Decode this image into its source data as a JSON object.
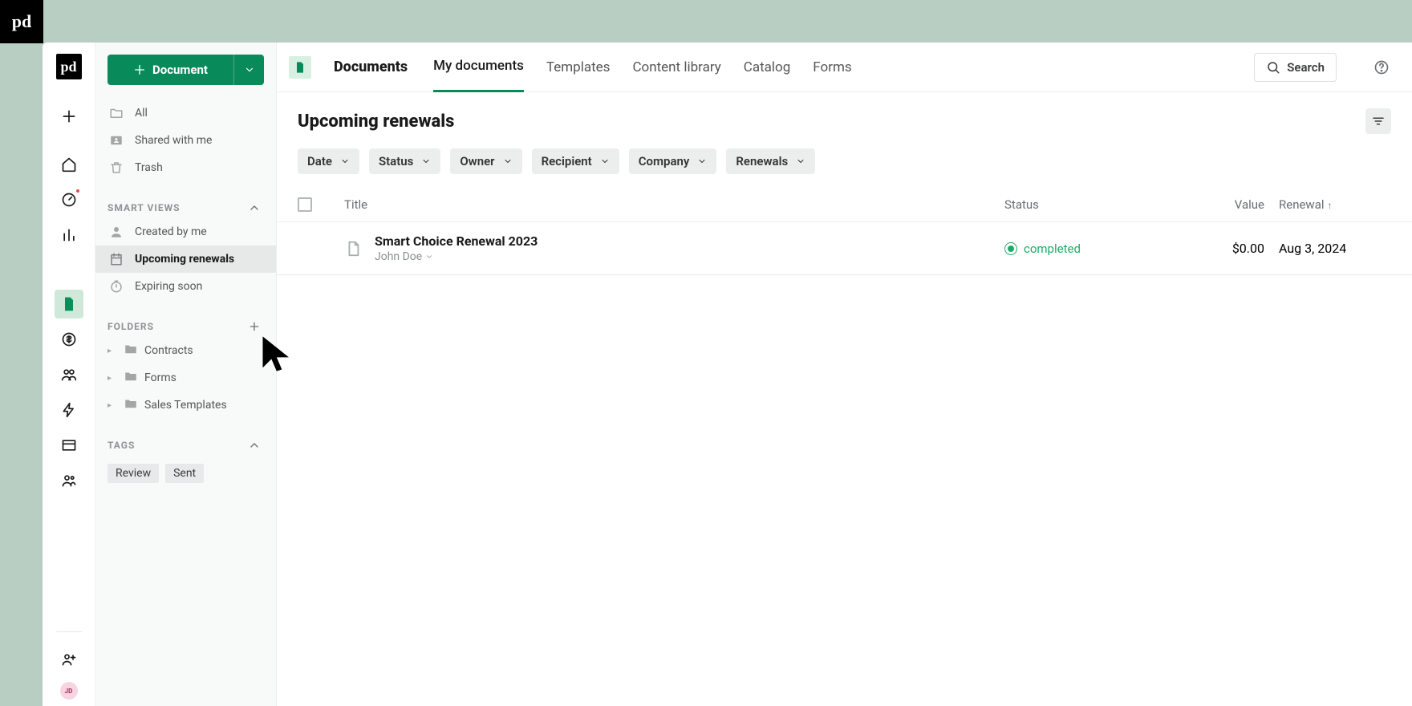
{
  "app": {
    "brand_mark": "pd",
    "brand_label": "Documents",
    "nav_tabs": [
      "My documents",
      "Templates",
      "Content library",
      "Catalog",
      "Forms"
    ],
    "active_tab_index": 0,
    "search_label": "Search"
  },
  "rail": {
    "avatar_initials": "JD"
  },
  "sidebar": {
    "document_button_label": "Document",
    "quick_items": [
      {
        "key": "all",
        "label": "All"
      },
      {
        "key": "shared",
        "label": "Shared with me"
      },
      {
        "key": "trash",
        "label": "Trash"
      }
    ],
    "smart_views_header": "SMART VIEWS",
    "smart_views": [
      {
        "key": "created_by_me",
        "label": "Created by me"
      },
      {
        "key": "upcoming_renewals",
        "label": "Upcoming renewals",
        "selected": true
      },
      {
        "key": "expiring_soon",
        "label": "Expiring soon"
      }
    ],
    "folders_header": "FOLDERS",
    "folders": [
      {
        "label": "Contracts"
      },
      {
        "label": "Forms"
      },
      {
        "label": "Sales Templates"
      }
    ],
    "tags_header": "TAGS",
    "tags": [
      "Review",
      "Sent"
    ]
  },
  "main": {
    "title": "Upcoming renewals",
    "filters": [
      "Date",
      "Status",
      "Owner",
      "Recipient",
      "Company",
      "Renewals"
    ],
    "columns": {
      "title": "Title",
      "status": "Status",
      "value": "Value",
      "renewal": "Renewal"
    },
    "sort_column": "renewal",
    "sort_dir": "asc",
    "rows": [
      {
        "title": "Smart Choice Renewal 2023",
        "author": "John Doe",
        "status_label": "completed",
        "value": "$0.00",
        "renewal": "Aug 3, 2024"
      }
    ]
  },
  "colors": {
    "primary": "#088a5a",
    "rail_selected_bg": "#cfe8da",
    "status_green": "#1eab66"
  }
}
